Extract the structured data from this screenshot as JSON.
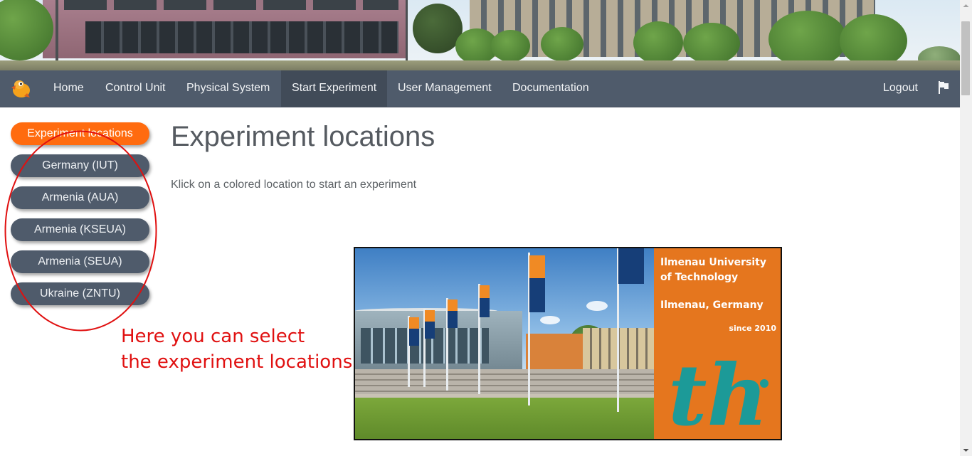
{
  "navbar": {
    "items": [
      {
        "label": "Home"
      },
      {
        "label": "Control Unit"
      },
      {
        "label": "Physical System"
      },
      {
        "label": "Start Experiment"
      },
      {
        "label": "User Management"
      },
      {
        "label": "Documentation"
      }
    ],
    "active": "Start Experiment",
    "logout_label": "Logout",
    "flag_icon": "flag-icon",
    "logo_icon": "bird-logo-icon"
  },
  "sidebar": {
    "items": [
      {
        "label": "Experiment locations",
        "active": true
      },
      {
        "label": "Germany (IUT)"
      },
      {
        "label": "Armenia (AUA)"
      },
      {
        "label": "Armenia (KSEUA)"
      },
      {
        "label": "Armenia (SEUA)"
      },
      {
        "label": "Ukraine (ZNTU)"
      }
    ]
  },
  "main": {
    "title": "Experiment locations",
    "instructions": "Klick on a colored location to start an experiment"
  },
  "annotation": {
    "line1": "Here you can select",
    "line2": "the experiment locations",
    "color": "#e01010"
  },
  "location_image": {
    "line1": "Ilmenau University",
    "line2": "of Technology",
    "line3": "Ilmenau, Germany",
    "since": "since 2010",
    "logo_text": "th"
  },
  "colors": {
    "navbar": "#4f5b6b",
    "active_nav": "#414b58",
    "accent_orange": "#ff6b0f",
    "panel_orange": "#e5761e",
    "logo_teal": "#1c9a98"
  }
}
